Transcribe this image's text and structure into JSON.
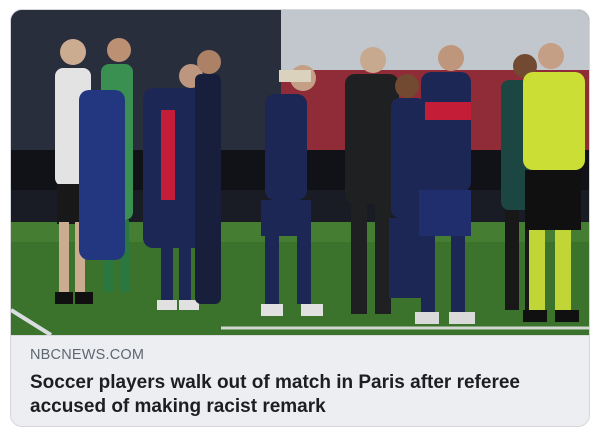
{
  "link_preview": {
    "source": "NBCNEWS.COM",
    "headline": "Soccer players walk out of match in Paris after referee accused of making racist remark",
    "image": {
      "kind": "news-photo"
    }
  },
  "colors": {
    "card_background": "#eceef1",
    "source_text": "#606770",
    "headline_text": "#1c1e21",
    "pitch_green": "#3f7a2f",
    "psg_navy": "#1f2a5c",
    "psg_red": "#d01f3c",
    "referee_yellow": "#d8ec3a"
  }
}
